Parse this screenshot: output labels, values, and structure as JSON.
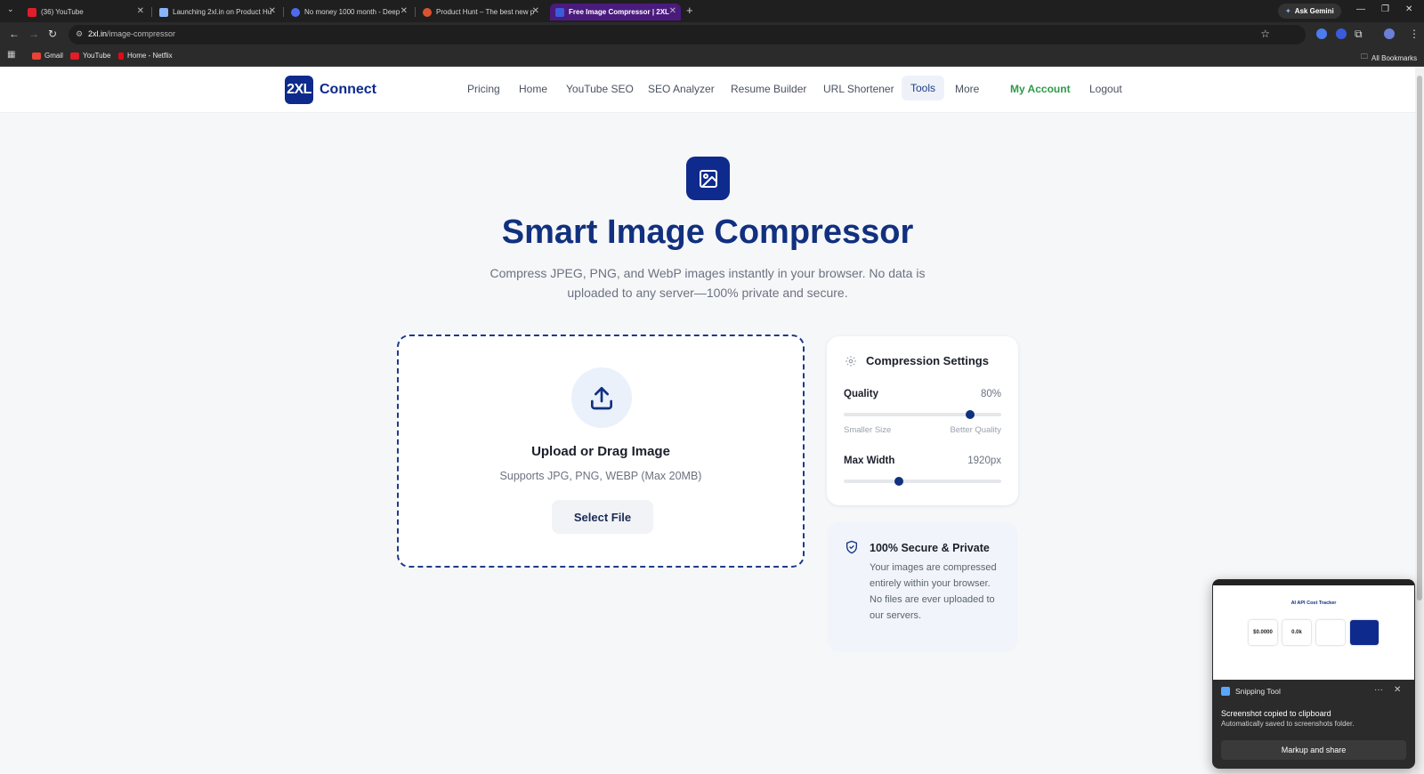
{
  "browser": {
    "tabs": [
      {
        "title": "(36) YouTube",
        "favicon_color": "#e11d2a"
      },
      {
        "title": "Launching 2xl.in on Product Hu",
        "favicon_color": "#8ab4f8"
      },
      {
        "title": "No money 1000 month - Deep",
        "favicon_color": "#4f6bed"
      },
      {
        "title": "Product Hunt – The best new p",
        "favicon_color": "#da552f"
      },
      {
        "title": "Free Image Compressor | 2XL",
        "favicon_color": "#3b5bdb"
      }
    ],
    "new_tab": "+",
    "ask_gemini": "Ask Gemini",
    "url_domain": "2xl.in",
    "url_path": "/image-compressor",
    "bookmarks": [
      {
        "label": "Gmail",
        "color": "#ea4335"
      },
      {
        "label": "YouTube",
        "color": "#e11d2a"
      },
      {
        "label": "Home - Netflix",
        "color": "#e50914"
      }
    ],
    "all_bookmarks": "All Bookmarks"
  },
  "header": {
    "logo_mark": "2XL",
    "logo_text": "Connect",
    "nav": [
      "Pricing",
      "Home",
      "YouTube SEO",
      "SEO Analyzer",
      "Resume Builder",
      "URL Shortener",
      "Tools",
      "More"
    ],
    "my_account": "My Account",
    "logout": "Logout"
  },
  "hero": {
    "title": "Smart Image Compressor",
    "subtitle": "Compress JPEG, PNG, and WebP images instantly in your browser. No data is uploaded to any server—100% private and secure."
  },
  "upload": {
    "title": "Upload or Drag Image",
    "hint": "Supports JPG, PNG, WEBP (Max 20MB)",
    "button": "Select File"
  },
  "settings": {
    "title": "Compression Settings",
    "quality_label": "Quality",
    "quality_value": "80%",
    "quality_fraction": 0.8,
    "smaller_label": "Smaller Size",
    "better_label": "Better Quality",
    "maxwidth_label": "Max Width",
    "maxwidth_value": "1920px",
    "maxwidth_fraction": 0.35
  },
  "secure": {
    "title": "100% Secure & Private",
    "body": "Your images are compressed entirely within your browser. No files are ever uploaded to our servers."
  },
  "toast": {
    "preview_title": "AI API Cost Tracker",
    "preview_values": [
      "$0.0000",
      "0.0k"
    ],
    "app": "Snipping Tool",
    "message": "Screenshot copied to clipboard",
    "sub": "Automatically saved to screenshots folder.",
    "button": "Markup and share"
  },
  "colors": {
    "brand": "#0e2a8c",
    "accent_green": "#2e9a4a",
    "active_tab": "#4a1b7d"
  }
}
